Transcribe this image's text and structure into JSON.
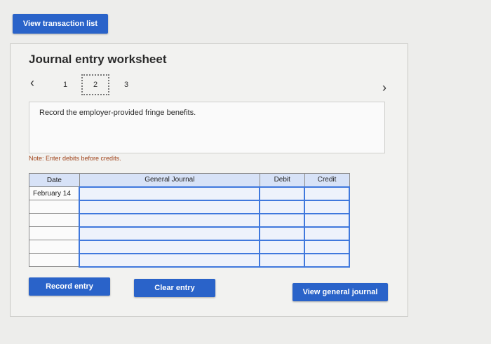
{
  "top_button": {
    "label": "View transaction list"
  },
  "worksheet": {
    "title": "Journal entry worksheet",
    "nav": {
      "prev_icon": "chevron-left-icon",
      "next_icon": "chevron-right-icon"
    },
    "steps": [
      "1",
      "2",
      "3"
    ],
    "current_step": "2",
    "instruction": "Record the employer-provided fringe benefits.",
    "note": "Note: Enter debits before credits."
  },
  "table": {
    "headers": {
      "date": "Date",
      "journal": "General Journal",
      "debit": "Debit",
      "credit": "Credit"
    },
    "rows": [
      {
        "date": "February 14",
        "journal": "",
        "debit": "",
        "credit": ""
      },
      {
        "date": "",
        "journal": "",
        "debit": "",
        "credit": ""
      },
      {
        "date": "",
        "journal": "",
        "debit": "",
        "credit": ""
      },
      {
        "date": "",
        "journal": "",
        "debit": "",
        "credit": ""
      },
      {
        "date": "",
        "journal": "",
        "debit": "",
        "credit": ""
      },
      {
        "date": "",
        "journal": "",
        "debit": "",
        "credit": ""
      }
    ]
  },
  "actions": {
    "record": "Record entry",
    "clear": "Clear entry",
    "view_journal": "View general journal"
  },
  "colors": {
    "accent": "#2a63c9",
    "header_bg": "#d7e2f7",
    "note": "#a0441b"
  }
}
